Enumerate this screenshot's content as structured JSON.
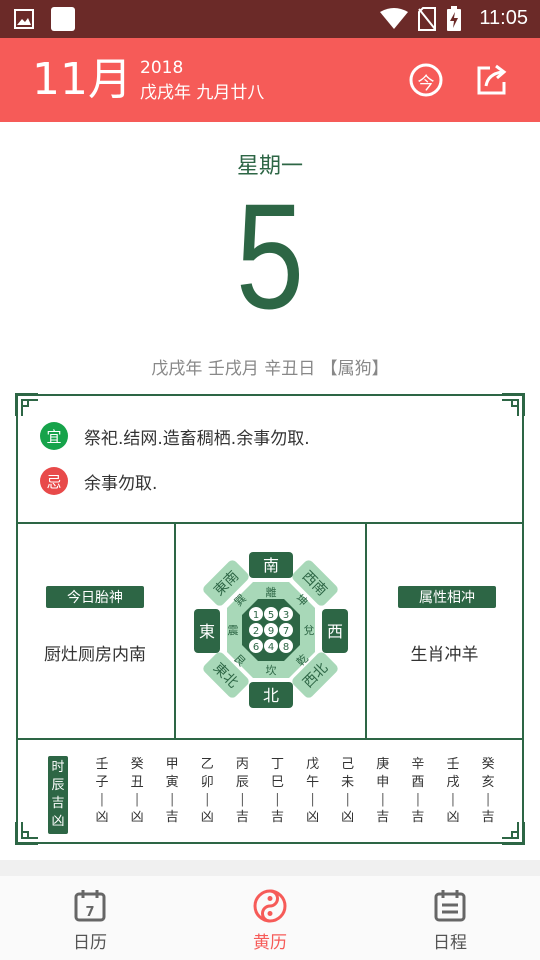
{
  "status_bar": {
    "time": "11:05",
    "icons": [
      "image-icon",
      "square-icon",
      "wifi-icon",
      "no-sim-icon",
      "battery-charging-icon"
    ]
  },
  "header": {
    "month": "11月",
    "year": "2018",
    "lunar": "戊戌年 九月廿八",
    "today_icon": "today-icon",
    "today_glyph": "今",
    "share_icon": "share-icon"
  },
  "day": {
    "weekday": "星期一",
    "number": "5",
    "ganzhi": "戊戌年 壬戌月 辛丑日 【属狗】"
  },
  "yiji": {
    "yi_label": "宜",
    "yi_text": "祭祀.结网.造畜稠栖.余事勿取.",
    "ji_label": "忌",
    "ji_text": "余事勿取."
  },
  "fetal_god": {
    "title": "今日胎神",
    "value": "厨灶厕房内南"
  },
  "compass": {
    "south": "南",
    "north": "北",
    "east": "東",
    "west": "西",
    "southeast": "東南",
    "southwest": "西南",
    "northeast": "東北",
    "northwest": "西北",
    "trigrams": [
      "離",
      "坤",
      "兌",
      "乾",
      "坎",
      "艮",
      "震",
      "巽"
    ],
    "grid": [
      "1",
      "5",
      "3",
      "2",
      "9",
      "7",
      "6",
      "4",
      "8"
    ]
  },
  "clash": {
    "title": "属性相冲",
    "value": "生肖冲羊"
  },
  "hours": {
    "label": "时辰吉凶",
    "items": [
      {
        "branch": "壬子",
        "luck": "凶"
      },
      {
        "branch": "癸丑",
        "luck": "凶"
      },
      {
        "branch": "甲寅",
        "luck": "吉"
      },
      {
        "branch": "乙卯",
        "luck": "凶"
      },
      {
        "branch": "丙辰",
        "luck": "吉"
      },
      {
        "branch": "丁巳",
        "luck": "吉"
      },
      {
        "branch": "戊午",
        "luck": "凶"
      },
      {
        "branch": "己未",
        "luck": "凶"
      },
      {
        "branch": "庚申",
        "luck": "吉"
      },
      {
        "branch": "辛酉",
        "luck": "吉"
      },
      {
        "branch": "壬戌",
        "luck": "凶"
      },
      {
        "branch": "癸亥",
        "luck": "吉"
      }
    ]
  },
  "nav": {
    "items": [
      {
        "label": "日历",
        "icon": "calendar-icon",
        "day": "7"
      },
      {
        "label": "黄历",
        "icon": "yin-yang-icon"
      },
      {
        "label": "日程",
        "icon": "schedule-icon"
      }
    ],
    "active_index": 1
  },
  "colors": {
    "accent": "#f65b58",
    "green": "#2d6645",
    "status_bar": "#6b2a28"
  }
}
